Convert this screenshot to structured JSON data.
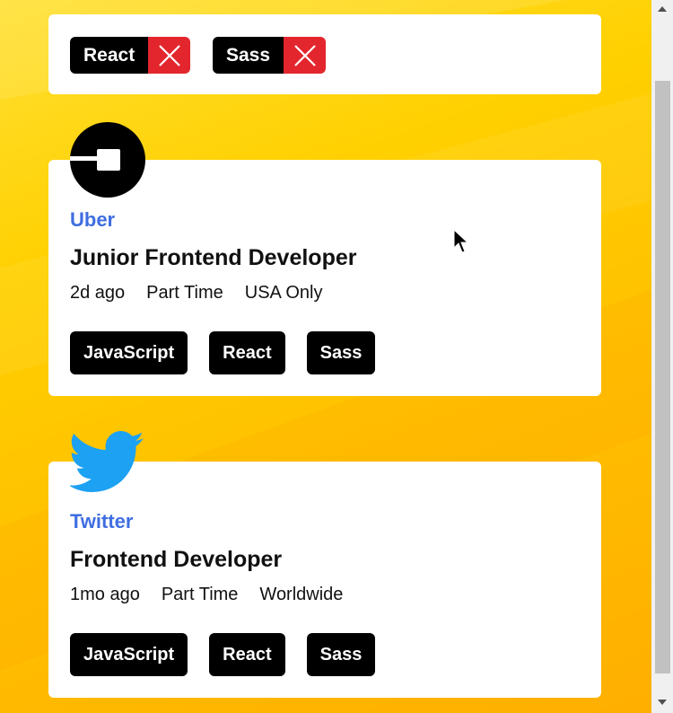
{
  "filters": [
    {
      "label": "React"
    },
    {
      "label": "Sass"
    }
  ],
  "jobs": [
    {
      "company": "Uber",
      "logo": "uber-logo-icon",
      "position": "Junior Frontend Developer",
      "posted": "2d ago",
      "contract": "Part Time",
      "location": "USA Only",
      "tags": [
        "JavaScript",
        "React",
        "Sass"
      ]
    },
    {
      "company": "Twitter",
      "logo": "twitter-logo-icon",
      "position": "Frontend Developer",
      "posted": "1mo ago",
      "contract": "Part Time",
      "location": "Worldwide",
      "tags": [
        "JavaScript",
        "React",
        "Sass"
      ]
    }
  ],
  "colors": {
    "accent": "#3f6ee0",
    "remove": "#e3262d",
    "tag_bg": "#000000",
    "background": "#ffc400",
    "twitter_blue": "#1da1f2"
  }
}
